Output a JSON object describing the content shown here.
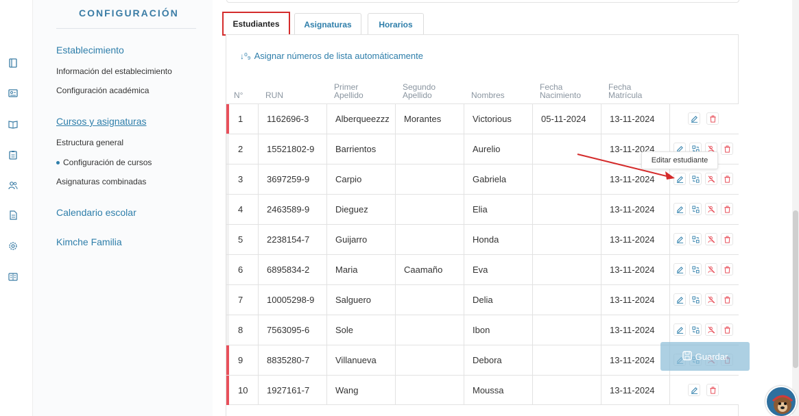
{
  "sidebar": {
    "title": "CONFIGURACIÓN",
    "sections": [
      {
        "label": "Establecimiento",
        "items": [
          "Información del establecimiento",
          "Configuración académica"
        ]
      },
      {
        "label": "Cursos y asignaturas",
        "items": [
          "Estructura general",
          "Configuración de cursos",
          "Asignaturas combinadas"
        ]
      },
      {
        "label": "Calendario escolar",
        "items": []
      },
      {
        "label": "Kimche Familia",
        "items": []
      }
    ]
  },
  "tabs": [
    "Estudiantes",
    "Asignaturas",
    "Horarios"
  ],
  "assign_link": "Asignar números de lista automáticamente",
  "table": {
    "headers": [
      "N°",
      "RUN",
      "Primer Apellido",
      "Segundo Apellido",
      "Nombres",
      "Fecha Nacimiento",
      "Fecha Matrícula"
    ],
    "rows": [
      {
        "n": "1",
        "run": "1162696-3",
        "ap1": "Alberqueezzz",
        "ap2": "Morantes",
        "nombres": "Victorious",
        "nac": "05-11-2024",
        "mat": "13-11-2024"
      },
      {
        "n": "2",
        "run": "15521802-9",
        "ap1": "Barrientos",
        "ap2": "",
        "nombres": "Aurelio",
        "nac": "",
        "mat": "13-11-2024"
      },
      {
        "n": "3",
        "run": "3697259-9",
        "ap1": "Carpio",
        "ap2": "",
        "nombres": "Gabriela",
        "nac": "",
        "mat": "13-11-2024"
      },
      {
        "n": "4",
        "run": "2463589-9",
        "ap1": "Dieguez",
        "ap2": "",
        "nombres": "Elia",
        "nac": "",
        "mat": "13-11-2024"
      },
      {
        "n": "5",
        "run": "2238154-7",
        "ap1": "Guijarro",
        "ap2": "",
        "nombres": "Honda",
        "nac": "",
        "mat": "13-11-2024"
      },
      {
        "n": "6",
        "run": "6895834-2",
        "ap1": "Maria",
        "ap2": "Caamaño",
        "nombres": "Eva",
        "nac": "",
        "mat": "13-11-2024"
      },
      {
        "n": "7",
        "run": "10005298-9",
        "ap1": "Salguero",
        "ap2": "",
        "nombres": "Delia",
        "nac": "",
        "mat": "13-11-2024"
      },
      {
        "n": "8",
        "run": "7563095-6",
        "ap1": "Sole",
        "ap2": "",
        "nombres": "Ibon",
        "nac": "",
        "mat": "13-11-2024"
      },
      {
        "n": "9",
        "run": "8835280-7",
        "ap1": "Villanueva",
        "ap2": "",
        "nombres": "Debora",
        "nac": "",
        "mat": "13-11-2024"
      },
      {
        "n": "10",
        "run": "1927161-7",
        "ap1": "Wang",
        "ap2": "",
        "nombres": "Moussa",
        "nac": "",
        "mat": "13-11-2024"
      }
    ]
  },
  "tooltip": "Editar estudiante",
  "save_button": "Guardar",
  "colors": {
    "accent": "#2e7eaa",
    "danger": "#e8505b",
    "highlight": "#d42b2b"
  }
}
